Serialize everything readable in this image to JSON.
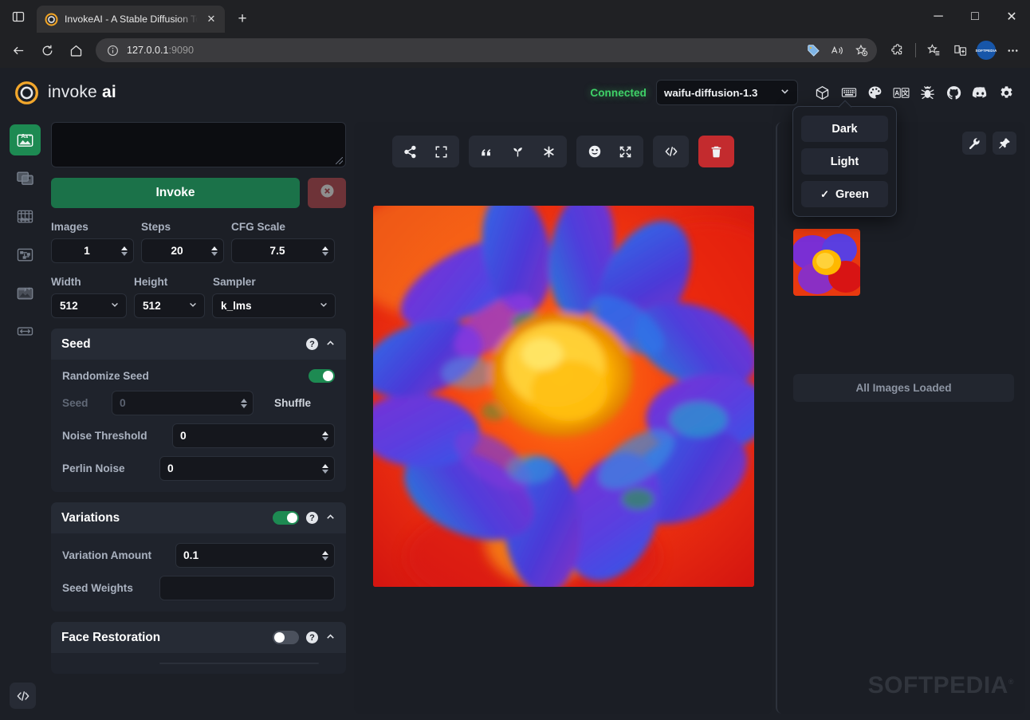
{
  "browser": {
    "tab": {
      "title": "InvokeAI - A Stable Diffusion Too",
      "favicon_name": "invokeai-favicon",
      "close_label": "✕"
    },
    "newtab_label": "+",
    "window_controls": {
      "minimize": "─",
      "maximize": "□",
      "close": "✕"
    },
    "nav": {
      "back": "←",
      "reload": "↻",
      "home": "⌂"
    },
    "omnibox": {
      "url_main": "127.0.0.1",
      "url_port": ":9090",
      "info_icon": "info-icon"
    },
    "toolbar_icons": [
      "price-tag-icon",
      "read-aloud-icon",
      "add-favorite-icon",
      "extensions-icon",
      "collections-icon",
      "split-screen-icon",
      "profile-avatar",
      "more-settings-icon"
    ],
    "profile_initials": "SOFTPEDIA"
  },
  "app": {
    "logo": {
      "name": "invoke",
      "bold": "ai"
    },
    "status": "Connected",
    "model": "waifu-diffusion-1.3",
    "header_icons": [
      "cube-icon",
      "keyboard-icon",
      "palette-icon",
      "language-icon",
      "bug-icon",
      "github-icon",
      "discord-icon",
      "settings-gear-icon"
    ],
    "theme_menu": {
      "items": [
        {
          "label": "Dark",
          "checked": false
        },
        {
          "label": "Light",
          "checked": false
        },
        {
          "label": "Green",
          "checked": true
        }
      ],
      "check_glyph": "✓"
    },
    "rail": [
      {
        "name": "text-to-image",
        "active": true
      },
      {
        "name": "image-to-image",
        "active": false
      },
      {
        "name": "unified-canvas",
        "active": false
      },
      {
        "name": "nodes",
        "active": false
      },
      {
        "name": "post-processing",
        "active": false
      },
      {
        "name": "training",
        "active": false
      }
    ],
    "rail_bottom": {
      "name": "console-toggle"
    },
    "options": {
      "prompt": {
        "value": "",
        "placeholder": ""
      },
      "invoke_label": "Invoke",
      "cancel_label": "cancel-icon",
      "fields": [
        {
          "label": "Images",
          "value": "1"
        },
        {
          "label": "Steps",
          "value": "20"
        },
        {
          "label": "CFG Scale",
          "value": "7.5"
        }
      ],
      "selects": [
        {
          "label": "Width",
          "value": "512"
        },
        {
          "label": "Height",
          "value": "512"
        },
        {
          "label": "Sampler",
          "value": "k_lms"
        }
      ],
      "seed": {
        "title": "Seed",
        "randomize_label": "Randomize Seed",
        "randomize_on": true,
        "seed_label": "Seed",
        "seed_value": "0",
        "shuffle_label": "Shuffle",
        "noise_threshold_label": "Noise Threshold",
        "noise_threshold_value": "0",
        "perlin_label": "Perlin Noise",
        "perlin_value": "0"
      },
      "variations": {
        "title": "Variations",
        "enabled": true,
        "amount_label": "Variation Amount",
        "amount_value": "0.1",
        "weights_label": "Seed Weights",
        "weights_value": ""
      },
      "face_restoration": {
        "title": "Face Restoration",
        "enabled": false
      }
    },
    "center_toolbar": {
      "groups": [
        [
          "share-icon",
          "fullscreen-icon"
        ],
        [
          "quote-icon",
          "seedling-icon",
          "asterisk-icon"
        ],
        [
          "smiley-icon",
          "expand-arrows-icon"
        ],
        [
          "code-icon"
        ],
        [
          "trash-icon"
        ]
      ]
    },
    "gallery": {
      "tools": [
        "wrench-icon",
        "pin-icon"
      ],
      "status": "All Images Loaded",
      "watermark": "SOFTPEDIA",
      "watermark_sup": "®"
    }
  }
}
